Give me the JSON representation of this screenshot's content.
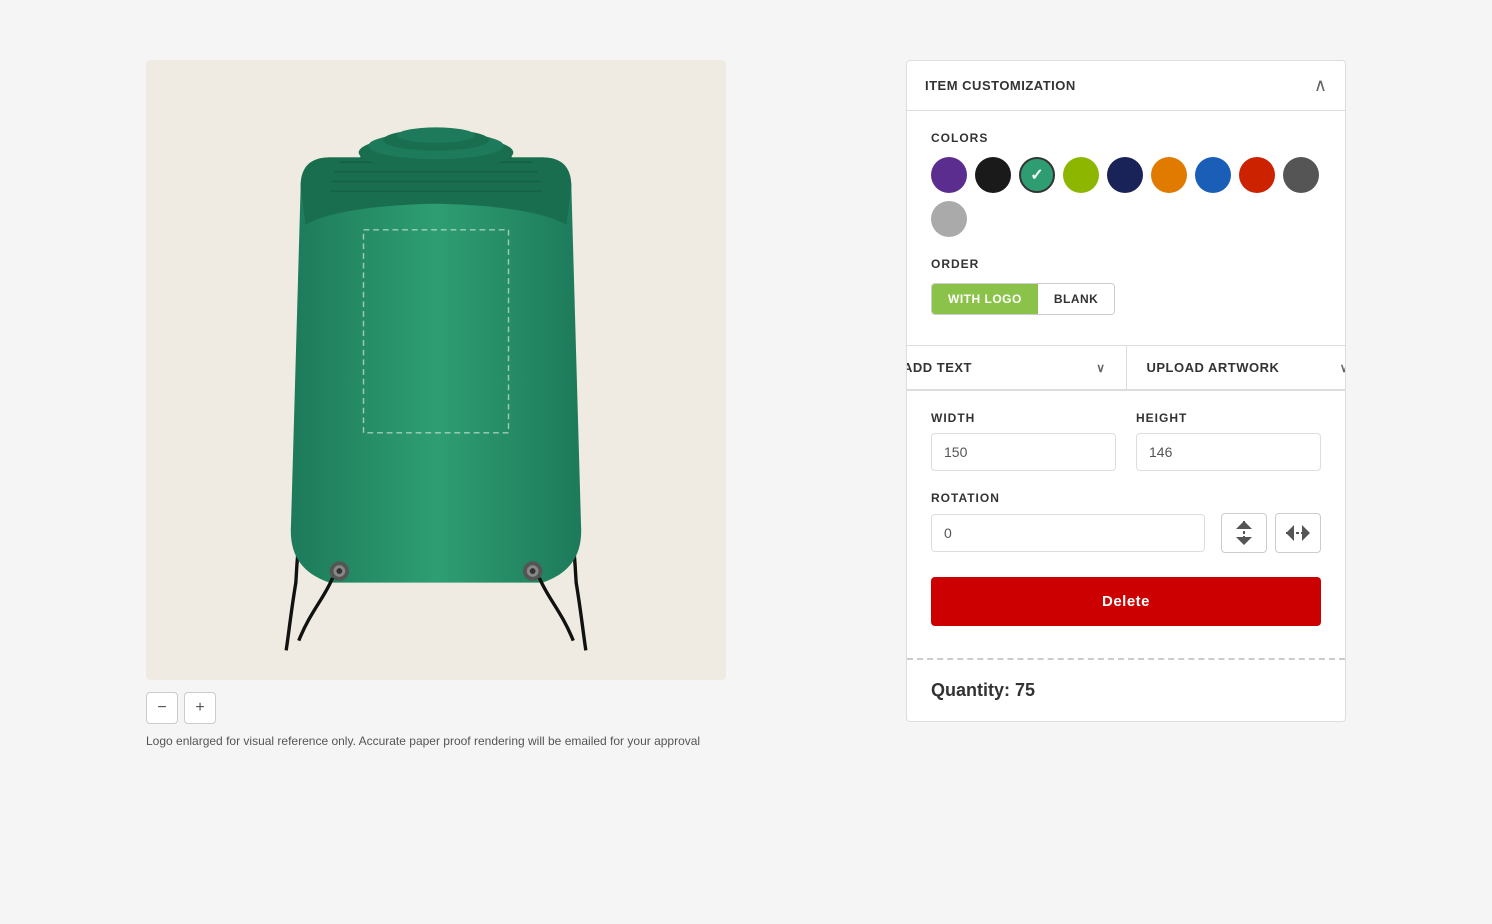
{
  "panel": {
    "title": "ITEM CUSTOMIZATION",
    "collapse_icon": "∧"
  },
  "colors": {
    "label": "COLORS",
    "swatches": [
      {
        "id": "purple",
        "hex": "#5b2d8e",
        "active": false
      },
      {
        "id": "black",
        "hex": "#1a1a1a",
        "active": false
      },
      {
        "id": "teal",
        "hex": "#2e8b6e",
        "active": true
      },
      {
        "id": "lime",
        "hex": "#8db600",
        "active": false
      },
      {
        "id": "navy",
        "hex": "#1a2357",
        "active": false
      },
      {
        "id": "orange",
        "hex": "#e07b00",
        "active": false
      },
      {
        "id": "blue",
        "hex": "#1a5eb8",
        "active": false
      },
      {
        "id": "red",
        "hex": "#cc2200",
        "active": false
      },
      {
        "id": "dark-gray",
        "hex": "#555555",
        "active": false
      },
      {
        "id": "gray",
        "hex": "#aaaaaa",
        "active": false
      }
    ]
  },
  "order": {
    "label": "ORDER",
    "buttons": [
      {
        "id": "with-logo",
        "label": "WITH LOGO",
        "active": true
      },
      {
        "id": "blank",
        "label": "BLANK",
        "active": false
      }
    ]
  },
  "actions": {
    "add_text_label": "ADD TEXT",
    "upload_artwork_label": "UPLOAD ARTWORK",
    "chevron": "∨"
  },
  "dimensions": {
    "width_label": "WIDTH",
    "height_label": "HEIGHT",
    "width_value": "150",
    "height_value": "146",
    "rotation_label": "ROTATION",
    "rotation_value": "0"
  },
  "delete_button": "Delete",
  "quantity": {
    "label": "Quantity: 75"
  },
  "disclaimer": "Logo enlarged for visual reference only. Accurate paper proof rendering will be emailed for your approval",
  "zoom": {
    "out_icon": "−",
    "in_icon": "+"
  }
}
